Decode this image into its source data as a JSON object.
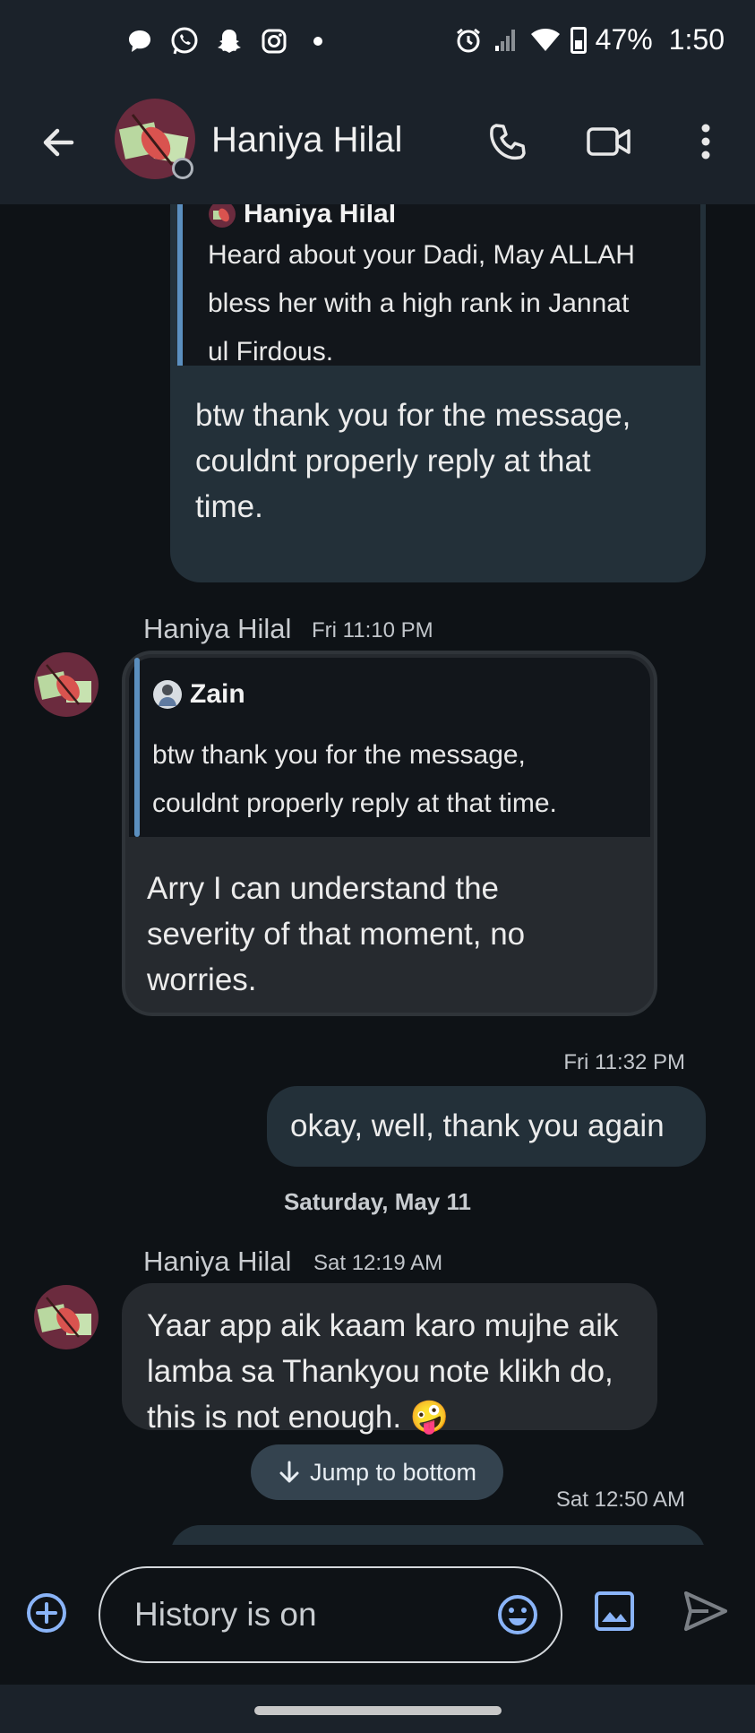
{
  "status_bar": {
    "battery": "47%",
    "time": "1:50",
    "left_icons": [
      "chat-bubble-icon",
      "whatsapp-icon",
      "snapchat-icon",
      "instagram-icon",
      "dot-icon"
    ],
    "right_icons": [
      "alarm-icon",
      "signal-icon",
      "wifi-icon",
      "battery-icon"
    ]
  },
  "header": {
    "contact_name": "Haniya Hilal"
  },
  "messages": {
    "out1": {
      "quote_author": "Haniya Hilal",
      "quote_text": [
        "Heard about your Dadi, May ALLAH",
        "bless her with a high rank in Jannat",
        "ul Firdous."
      ],
      "text": [
        "btw thank you for the message,",
        "couldnt properly reply at that",
        "time."
      ]
    },
    "in1": {
      "sender": "Haniya Hilal",
      "timestamp": "Fri 11:10 PM",
      "quote_author": "Zain",
      "quote_text": [
        "btw thank you for the message,",
        "couldnt properly reply at that time."
      ],
      "text": [
        "Arry I can understand the",
        "severity of that moment, no",
        "worries."
      ]
    },
    "out2": {
      "timestamp": "Fri 11:32 PM",
      "text": "okay, well, thank you again"
    },
    "date_separator": "Saturday, May 11",
    "in2": {
      "sender": "Haniya Hilal",
      "timestamp": "Sat 12:19 AM",
      "text": [
        "Yaar app aik kaam karo mujhe aik",
        "lamba sa Thankyou note klikh do,",
        "this is not enough. 🤪"
      ]
    },
    "out3": {
      "timestamp": "Sat 12:50 AM"
    }
  },
  "jump_button": "Jump to bottom",
  "composer": {
    "placeholder": "History is on"
  },
  "colors": {
    "background": "#0e1216",
    "bar": "#1b222a",
    "outgoing_bubble": "#233039",
    "incoming_bubble": "#262a2f",
    "accent": "#8ab4f8"
  }
}
